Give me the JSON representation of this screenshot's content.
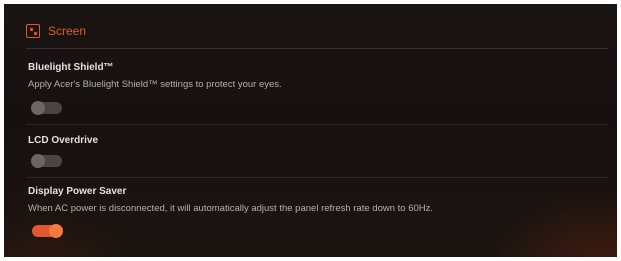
{
  "section": {
    "title": "Screen",
    "icon": "screen-icon",
    "accent_color": "#e2582c"
  },
  "settings": [
    {
      "title": "Bluelight Shield™",
      "description": "Apply Acer's Bluelight Shield™ settings to protect your eyes.",
      "enabled": false
    },
    {
      "title": "LCD Overdrive",
      "description": "",
      "enabled": false
    },
    {
      "title": "Display Power Saver",
      "description": "When AC power is disconnected, it will automatically adjust the panel refresh rate down to 60Hz.",
      "enabled": true
    }
  ]
}
